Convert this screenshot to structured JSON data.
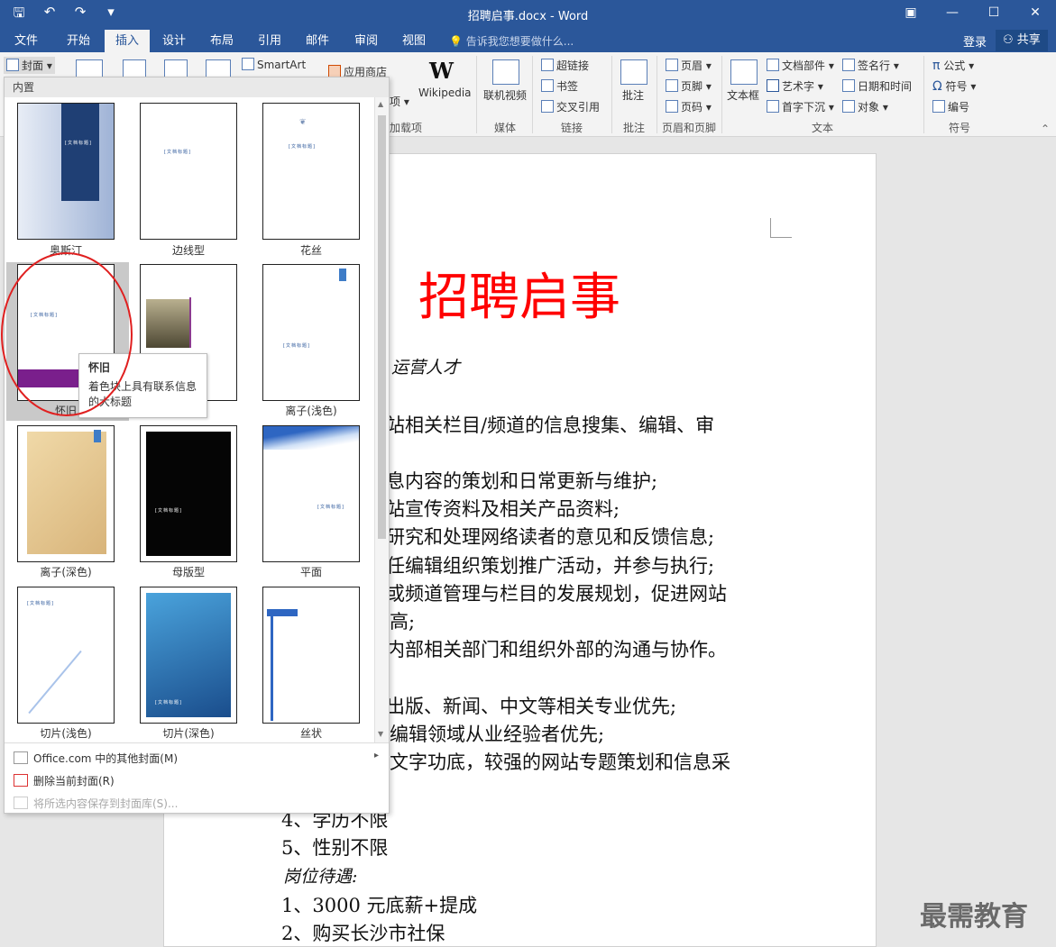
{
  "window": {
    "title": "招聘启事.docx - Word"
  },
  "tabs": [
    "文件",
    "开始",
    "插入",
    "设计",
    "布局",
    "引用",
    "邮件",
    "审阅",
    "视图"
  ],
  "active_tab": "插入",
  "tell_me": "告诉我您想要做什么...",
  "account": {
    "login": "登录",
    "share": "共享"
  },
  "ribbon": {
    "cover_button": "封面",
    "smartart": "SmartArt",
    "app_store": "应用商店",
    "addins_partial": "项",
    "wikipedia": "Wikipedia",
    "online_video": "联机视频",
    "hyperlink": "超链接",
    "bookmark": "书签",
    "cross_ref": "交叉引用",
    "comment": "批注",
    "header": "页眉",
    "footer": "页脚",
    "page_number": "页码",
    "textbox": "文本框",
    "doc_parts": "文档部件",
    "wordart": "艺术字",
    "dropcap": "首字下沉",
    "signature": "签名行",
    "datetime": "日期和时间",
    "object": "对象",
    "equation": "公式",
    "symbol": "符号",
    "numbering": "编号",
    "groups": {
      "addins_partial": "加载项",
      "media": "媒体",
      "links": "链接",
      "comments": "批注",
      "header_footer": "页眉和页脚",
      "text": "文本",
      "symbols": "符号"
    }
  },
  "dropdown": {
    "header": "内置",
    "covers": [
      "奥斯汀",
      "边线型",
      "花丝",
      "怀旧",
      "离子(浅色)",
      "离子(深色)",
      "母版型",
      "平面",
      "切片(浅色)",
      "切片(深色)",
      "丝状"
    ],
    "placeholder": "[文档标题]",
    "menu": [
      {
        "label": "Office.com 中的其他封面(M)",
        "enabled": true
      },
      {
        "label": "删除当前封面(R)",
        "enabled": true
      },
      {
        "label": "将所选内容保存到封面库(S)...",
        "enabled": false
      }
    ],
    "tooltip": {
      "title": "怀旧",
      "text_line1": "着色块上具有联系信息",
      "text_line2": "的大标题"
    }
  },
  "document": {
    "title": "招聘启事",
    "lines": [
      "运营人才",
      "站相关栏目/频道的信息搜集、编辑、审",
      "息内容的策划和日常更新与维护;",
      "站宣传资料及相关产品资料;",
      "研究和处理网络读者的意见和反馈信息;",
      "任编辑组织策划推广活动，并参与执行;",
      "或频道管理与栏目的发展规划，促进网站",
      "高;",
      "内部相关部门和组织外部的沟通与协作。",
      "出版、新闻、中文等相关专业优先;",
      "编辑领域从业经验者优先;",
      "文字功底，较强的网站专题策划和信息采",
      "4、学历不限",
      "5、性别不限",
      "岗位待遇:",
      "1、3000 元底薪+提成",
      "2、购买长沙市社保"
    ]
  },
  "watermark": "最需教育",
  "colors": {
    "brand": "#2b579a",
    "title_red": "#ff0000",
    "annotation": "#e02020"
  }
}
